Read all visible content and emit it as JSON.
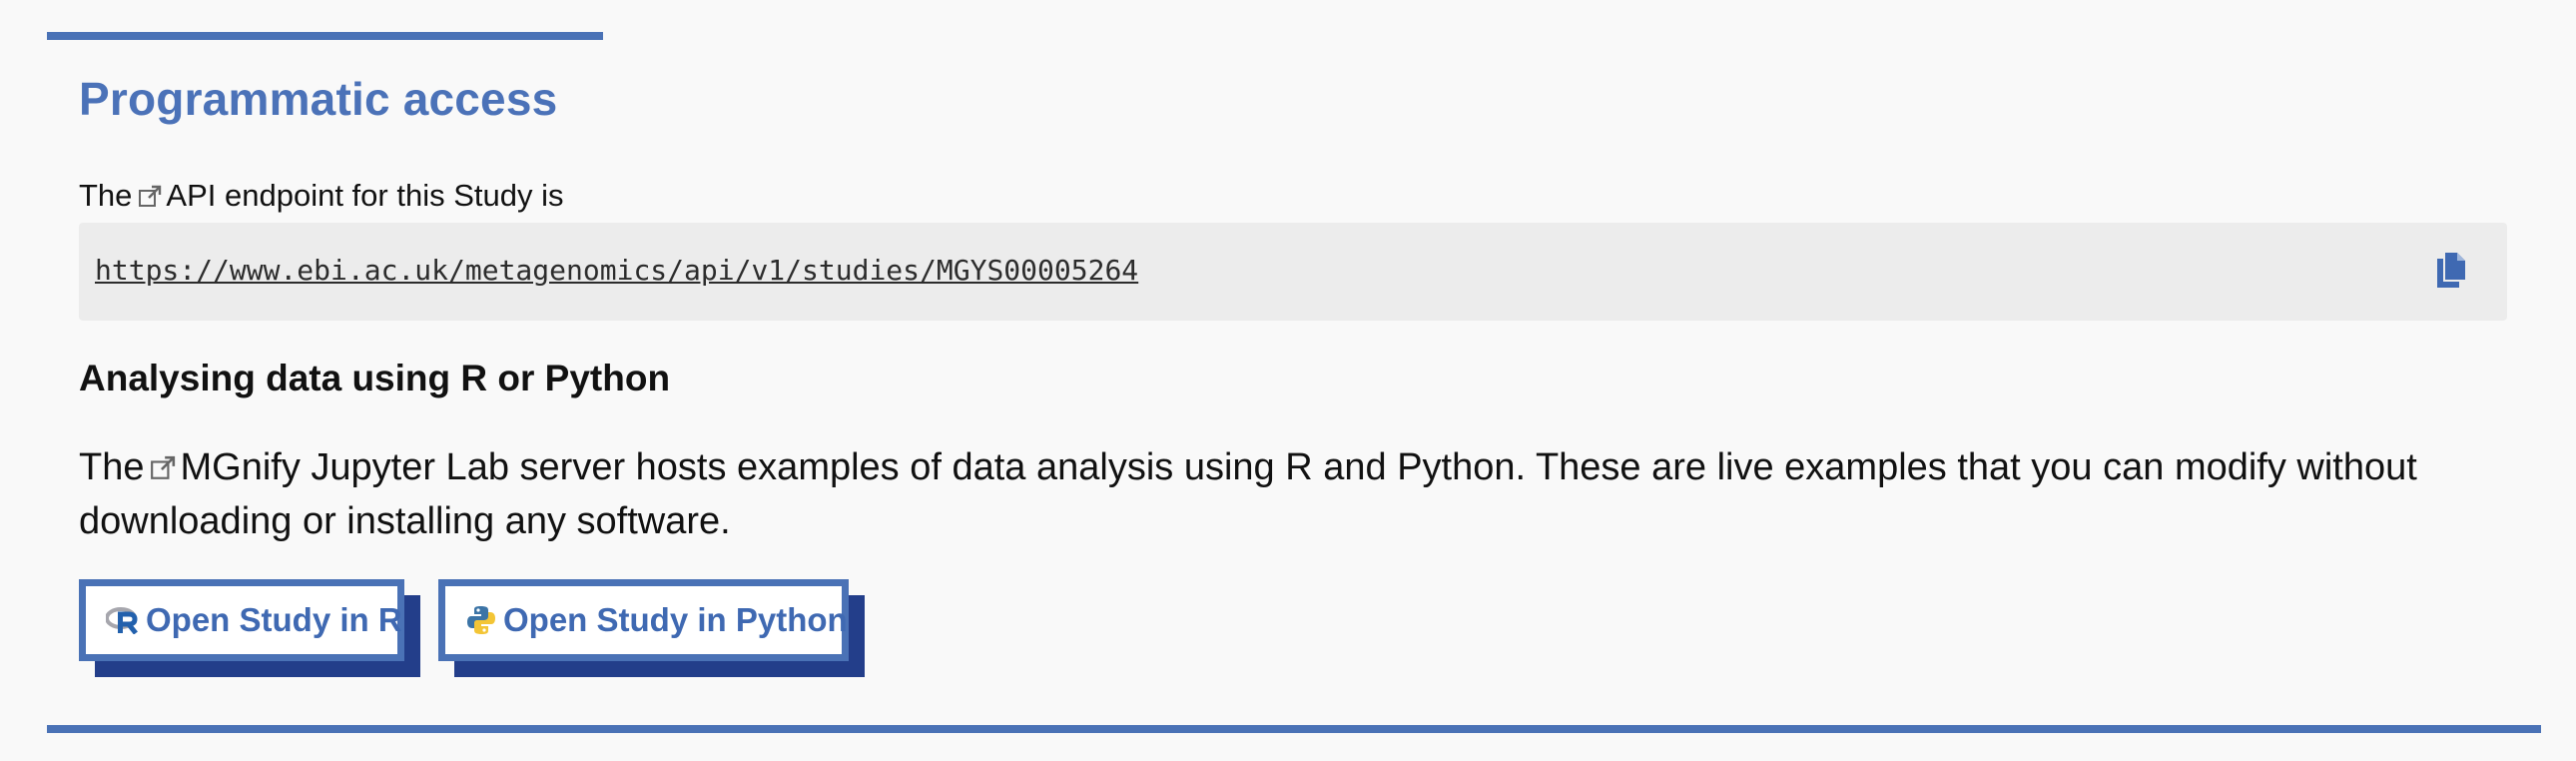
{
  "section": {
    "title": "Programmatic access"
  },
  "api": {
    "prefix": "The",
    "link_text": "API endpoint for this Study is",
    "endpoint_url": "https://www.ebi.ac.uk/metagenomics/api/v1/studies/MGYS00005264",
    "copy_icon": "copy-icon"
  },
  "analysis": {
    "heading": "Analysing data using R or Python",
    "prefix": "The",
    "link_text": "MGnify Jupyter Lab",
    "rest_text": "server hosts examples of data analysis using R and Python. These are live examples that you can modify without downloading or installing any software."
  },
  "buttons": {
    "r_label": "Open Study in R",
    "python_label": "Open Study in Python",
    "r_icon": "r-logo-icon",
    "python_icon": "python-logo-icon"
  },
  "colors": {
    "accent": "#4a72b6",
    "button_shadow": "#233e8a",
    "code_background": "#ececec"
  }
}
